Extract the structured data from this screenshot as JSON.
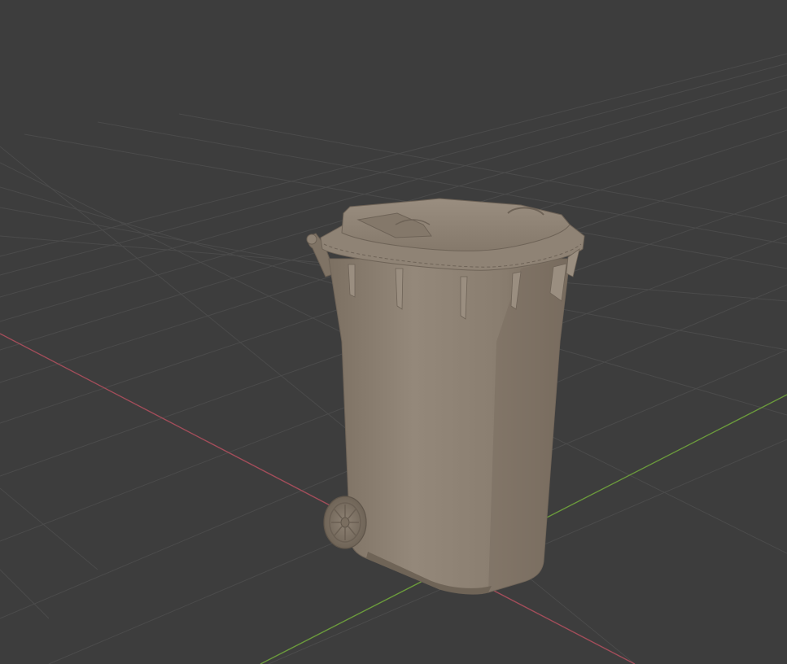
{
  "viewport": {
    "background": "#3d3d3d",
    "grid_color": "#4d4d4d",
    "x_axis_color": "#b05060",
    "y_axis_color": "#6a9a3a"
  },
  "object": {
    "name": "wheelie bin",
    "material_color": "#8a7d6e",
    "shadow_color": "#6e6357",
    "highlight_color": "#9c8f80"
  }
}
